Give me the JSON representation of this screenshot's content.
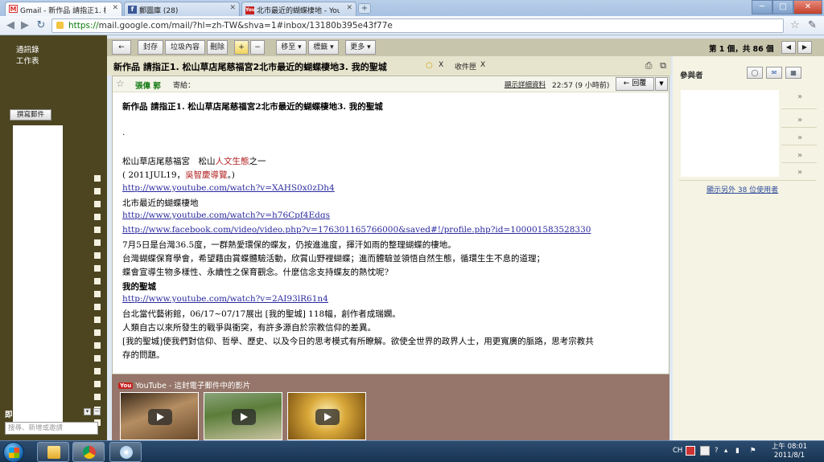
{
  "browser": {
    "tabs": [
      {
        "label": "Gmail - 新作品 請指正1. 松"
      },
      {
        "label": "郵圖庫 (28)"
      },
      {
        "label": "北市最近的蝴蝶棲地 - You"
      }
    ],
    "url_scheme": "https://",
    "url_rest": "mail.google.com/mail/?hl=zh-TW&shva=1#inbox/13180b395e43f77e",
    "window_min": "─",
    "window_max": "□",
    "window_close": "✕"
  },
  "sidebar": {
    "items": [
      "通訊錄",
      "工作表"
    ],
    "compose_label": "撰寫郵件",
    "chat_label": "即時通訊",
    "chat_search_placeholder": "搜尋、新增或邀請"
  },
  "actionbar": {
    "back": "←",
    "archive": "封存",
    "spam": "垃圾內容",
    "delete": "刪除",
    "plus": "+",
    "minus": "−",
    "move": "移至 ▾",
    "labels": "標籤 ▾",
    "more": "更多 ▾",
    "pager": "第 1 個，共 86 個",
    "prev": "◀",
    "next": "▶"
  },
  "subject": {
    "title": "新作品 請指正1. 松山草店尾慈福宮2北市最近的蝴蝶棲地3. 我的聖城",
    "tag_x": "X",
    "inbox_label": "收件匣",
    "inbox_x": "X"
  },
  "message": {
    "sender": "張偉 郭",
    "sender_suffix": "寄給：",
    "show_details": "顯示詳細資料",
    "time": "22:57 (9 小時前)",
    "reply": "← 回覆",
    "more": "▼",
    "lines": {
      "title": "新作品 請指正1. 松山草店尾慈福宮2北市最近的蝴蝶棲地3. 我的聖城",
      "dot": ".",
      "l1a": "松山草店尾慈福宮　松山",
      "l1b": "人文生態",
      "l1c": "之一",
      "l2a": "( 2011JUL19，",
      "l2b": "吳智慶導覽",
      "l2c": "。)",
      "link1": "http://www.youtube.com/watch?v=XAHS0x0zDh4",
      "l3": "北市最近的蝴蝶棲地",
      "link2": "http://www.youtube.com/watch?v=h76Cpf4Edqs",
      "link3": "http://www.facebook.com/video/video.php?v=176301165766000&saved#!/profile.php?id=100001583528330",
      "l4": "7月5日是台灣36.5度，一群熱愛環保的蝶友，仍按進進度，揮汗如雨的整理蝴蝶的棲地。",
      "l5": "台灣蝴蝶保育學會，希望藉由賞蝶體驗活動，欣賞山野裡蝴蝶；進而體驗並領悟自然生態，循環生生不息的道理；",
      "l6": "蝶會宣導生物多樣性、永續性之保育觀念。什麼信念支持蝶友的熱忱呢?",
      "l7": "我的聖城",
      "link4": "http://www.youtube.com/watch?v=2AI93lR61n4",
      "l8": "台北當代藝術館，06/17~07/17展出 [我的聖城] 118幅，創作者成瑞嫻。",
      "l9": "人類自古以來所發生的戰爭與衝突，有許多源自於宗教信仰的差異。",
      "l10": "[我的聖城]使我們對信仰、哲學、歷史、以及今日的思考模式有所瞭解。欲使全世界的政界人士，用更寬廣的脈路，思考宗教共",
      "l11": "存的問題。"
    }
  },
  "youtube": {
    "logo": "You",
    "label": "YouTube - 這封電子郵件中的影片"
  },
  "participants": {
    "title": "參與者",
    "show_more": "顯示另外 38 位使用者",
    "chevron": "»"
  },
  "taskbar": {
    "lang": "CH",
    "time": "上午 08:01",
    "date": "2011/8/1"
  }
}
